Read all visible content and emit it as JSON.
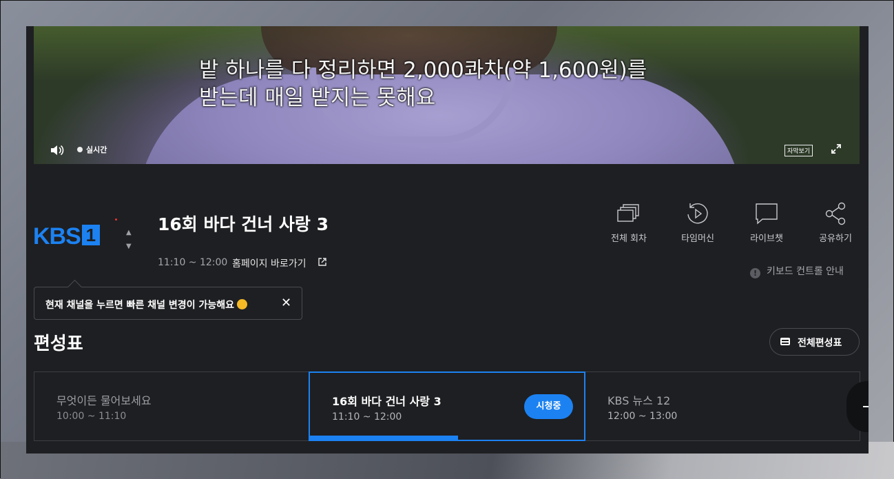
{
  "video": {
    "subtitle_line1": "밭 하나를 다 정리하면 2,000콰차(약 1,600원)를",
    "subtitle_line2": "받는데 매일 받지는 못해요",
    "live_label": "실시간",
    "subtitles_button": "자막보기"
  },
  "channel": {
    "logo_text": "KBS",
    "logo_number": "1"
  },
  "program": {
    "title": "16회 바다 건너 사랑 3",
    "time": "11:10 ~ 12:00",
    "homepage_link": "홈페이지 바로가기"
  },
  "tooltip": {
    "message": "현재 채널을 누르면 빠른 채널 변경이 가능해요"
  },
  "actions": [
    {
      "label": "전체 회차",
      "icon": "episodes-icon"
    },
    {
      "label": "타임머신",
      "icon": "timemachine-icon"
    },
    {
      "label": "라이브챗",
      "icon": "chat-icon"
    },
    {
      "label": "공유하기",
      "icon": "share-icon"
    }
  ],
  "keyboard_guide": "키보드 컨트롤 안내",
  "schedule": {
    "title": "편성표",
    "full_button": "전체편성표",
    "items": [
      {
        "title": "무엇이든 물어보세요",
        "time": "10:00 ~ 11:10",
        "state": "past"
      },
      {
        "title": "16회 바다 건너 사랑 3",
        "time": "11:10 ~ 12:00",
        "state": "now",
        "badge": "시청중",
        "progress": 0.54
      },
      {
        "title": "KBS 뉴스 12",
        "time": "12:00 ~ 13:00",
        "state": "next"
      }
    ]
  },
  "colors": {
    "accent": "#1c82f2",
    "panel": "#1e1f22"
  }
}
